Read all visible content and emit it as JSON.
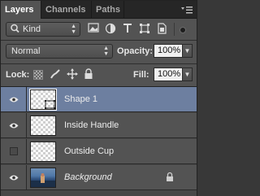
{
  "tabs": [
    {
      "label": "Layers",
      "active": true
    },
    {
      "label": "Channels",
      "active": false
    },
    {
      "label": "Paths",
      "active": false
    }
  ],
  "filter": {
    "kind_label": "Kind",
    "icons": [
      "image-filter-icon",
      "adjustment-filter-icon",
      "type-filter-icon",
      "shape-filter-icon",
      "smart-object-filter-icon",
      "filter-toggle-icon"
    ]
  },
  "blend": {
    "mode": "Normal",
    "opacity_label": "Opacity:",
    "opacity_value": "100%"
  },
  "lock": {
    "label": "Lock:",
    "fill_label": "Fill:",
    "fill_value": "100%",
    "icons": [
      "lock-transparent-icon",
      "lock-image-icon",
      "lock-position-icon",
      "lock-all-icon"
    ]
  },
  "layers": [
    {
      "name": "Shape 1",
      "visible": true,
      "selected": true,
      "italic": false,
      "locked": false
    },
    {
      "name": "Inside Handle",
      "visible": true,
      "selected": false,
      "italic": false,
      "locked": false
    },
    {
      "name": "Outside Cup",
      "visible": false,
      "selected": false,
      "italic": false,
      "locked": false
    },
    {
      "name": "Background",
      "visible": true,
      "selected": false,
      "italic": true,
      "locked": true
    }
  ]
}
